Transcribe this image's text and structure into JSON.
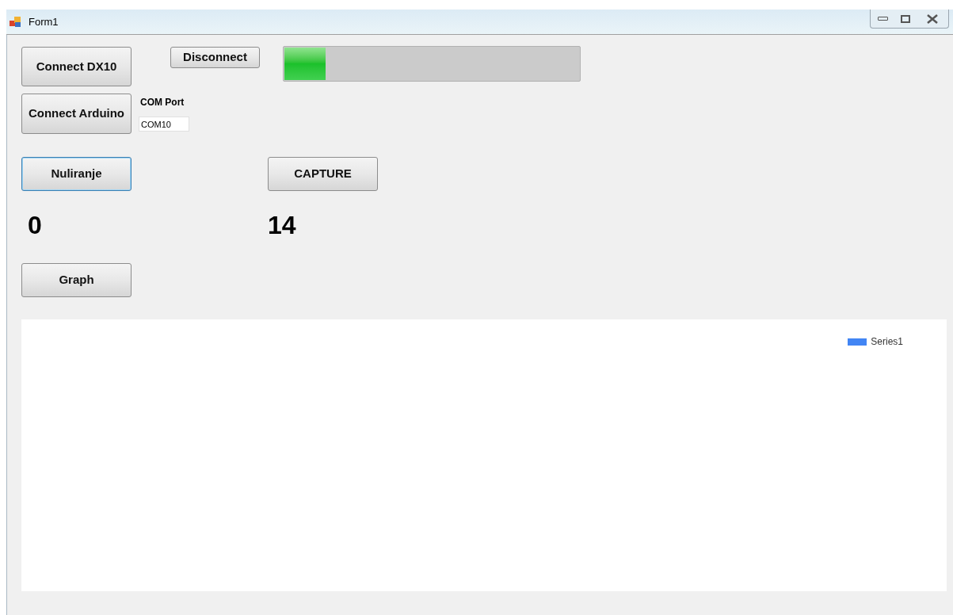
{
  "window": {
    "title": "Form1"
  },
  "buttons": [
    {
      "label": "Connect DX10",
      "focused": false
    },
    {
      "label": "Disconnect",
      "focused": false
    },
    {
      "label": "Connect Arduino",
      "focused": false
    },
    {
      "label": "Nuliranje",
      "focused": true
    },
    {
      "label": "CAPTURE",
      "focused": false
    },
    {
      "label": "Graph",
      "focused": false
    }
  ],
  "progress": {
    "level": 0.14
  },
  "com_port": {
    "label": "COM Port",
    "value": "COM10"
  },
  "readings": [
    "0",
    "14"
  ],
  "chart": {
    "legend": [
      {
        "name": "Series1",
        "color": "#4285f4"
      }
    ]
  }
}
